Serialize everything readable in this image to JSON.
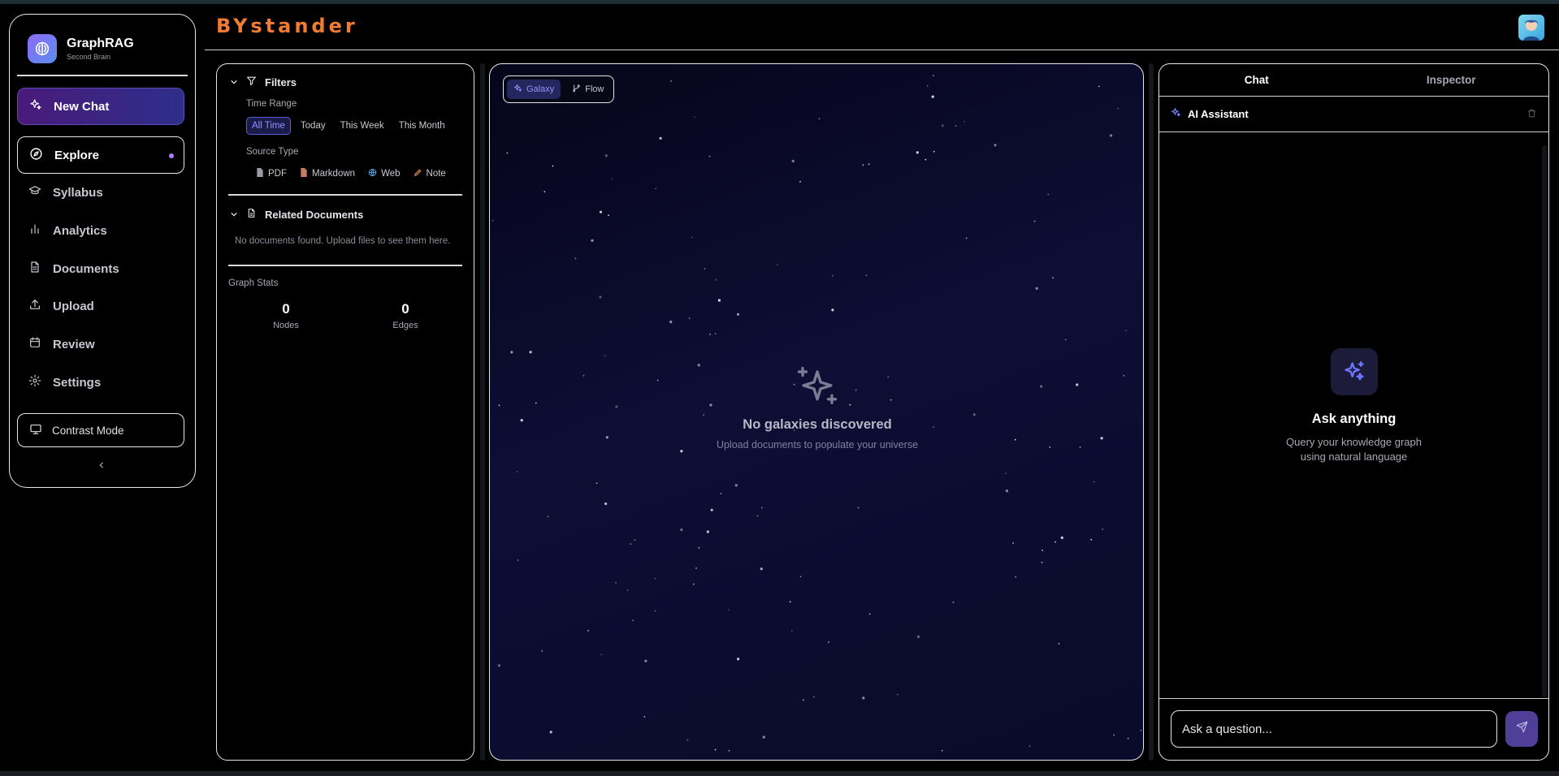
{
  "app": {
    "title": "BYstander"
  },
  "brand": {
    "name": "GraphRAG",
    "subtitle": "Second Brain"
  },
  "sidebar": {
    "new_chat": "New Chat",
    "items": [
      {
        "label": "Explore",
        "icon": "compass-icon",
        "active": true
      },
      {
        "label": "Syllabus",
        "icon": "graduation-cap-icon"
      },
      {
        "label": "Analytics",
        "icon": "bar-chart-icon"
      },
      {
        "label": "Documents",
        "icon": "document-icon"
      },
      {
        "label": "Upload",
        "icon": "upload-icon"
      },
      {
        "label": "Review",
        "icon": "calendar-icon"
      },
      {
        "label": "Settings",
        "icon": "gear-icon"
      }
    ],
    "contrast_mode": "Contrast Mode"
  },
  "filters": {
    "title": "Filters",
    "time_range_label": "Time Range",
    "time_ranges": [
      "All Time",
      "Today",
      "This Week",
      "This Month"
    ],
    "selected_time_range": "All Time",
    "source_type_label": "Source Type",
    "source_types": [
      "PDF",
      "Markdown",
      "Web",
      "Note"
    ],
    "related_title": "Related Documents",
    "related_empty": "No documents found. Upload files to see them here.",
    "stats_title": "Graph Stats",
    "nodes_value": "0",
    "nodes_label": "Nodes",
    "edges_value": "0",
    "edges_label": "Edges"
  },
  "canvas": {
    "views": [
      "Galaxy",
      "Flow"
    ],
    "active_view": "Galaxy",
    "empty_title": "No galaxies discovered",
    "empty_subtitle": "Upload documents to populate your universe"
  },
  "chat": {
    "tabs": [
      "Chat",
      "Inspector"
    ],
    "active_tab": "Chat",
    "assistant_title": "AI Assistant",
    "empty_title": "Ask anything",
    "empty_subtitle_1": "Query your knowledge graph",
    "empty_subtitle_2": "using natural language",
    "input_placeholder": "Ask a question..."
  },
  "colors": {
    "accent": "#f07b34",
    "primary": "#8e93ff",
    "highlight": "#a77bff"
  }
}
